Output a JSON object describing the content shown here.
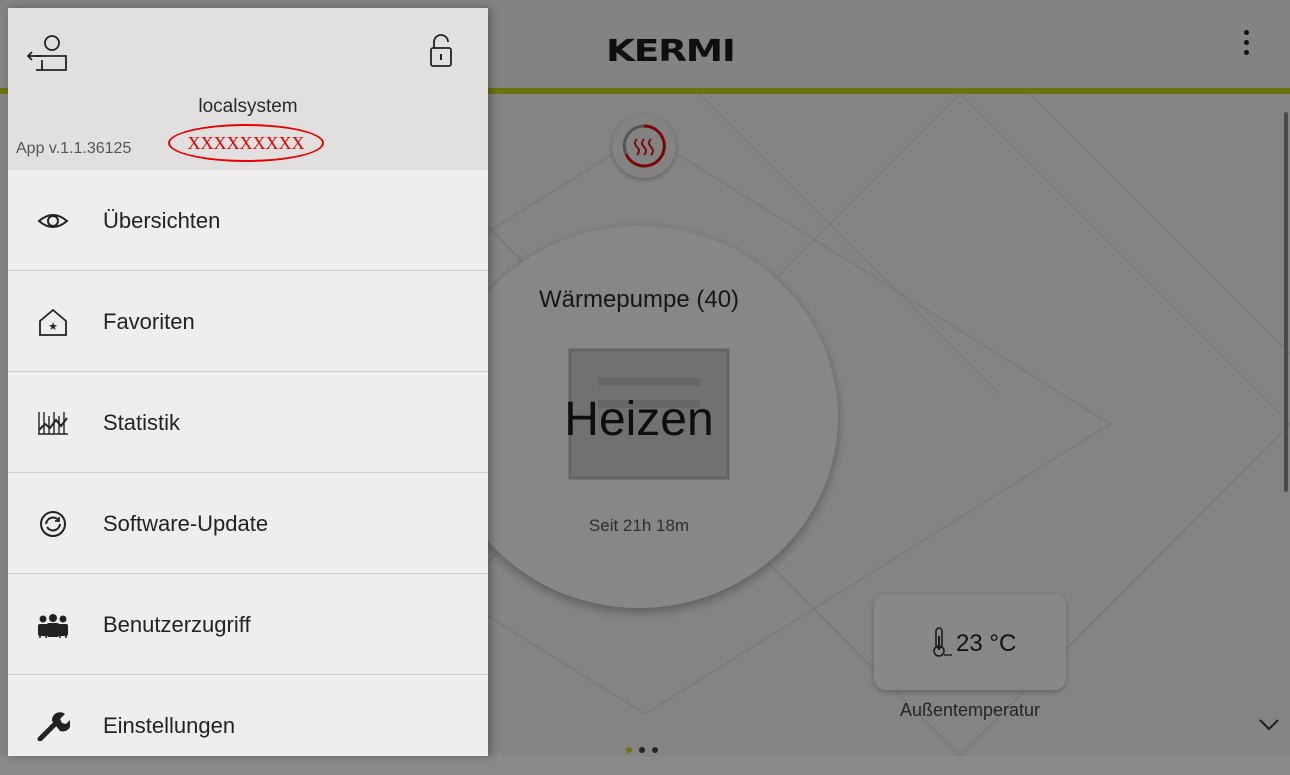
{
  "app": {
    "brand": "KERMI",
    "device_title": "Wärmepumpe (40)",
    "device_state": "Heizen",
    "device_since": "Seit 21h 18m",
    "outdoor_temp": "23 °C",
    "outdoor_label": "Außentemperatur",
    "pager": {
      "count": 3,
      "active": 1
    },
    "accent_color": "#c3d11f"
  },
  "drawer": {
    "system_name": "localsystem",
    "app_version": "App v.1.1.36125",
    "redacted_text": "XXXXXXXXX",
    "menu": [
      {
        "label": "Übersichten",
        "icon": "eye-icon"
      },
      {
        "label": "Favoriten",
        "icon": "favorite-home-icon"
      },
      {
        "label": "Statistik",
        "icon": "statistics-icon"
      },
      {
        "label": "Software-Update",
        "icon": "update-icon"
      },
      {
        "label": "Benutzerzugriff",
        "icon": "users-icon"
      },
      {
        "label": "Einstellungen",
        "icon": "wrench-icon"
      }
    ]
  }
}
